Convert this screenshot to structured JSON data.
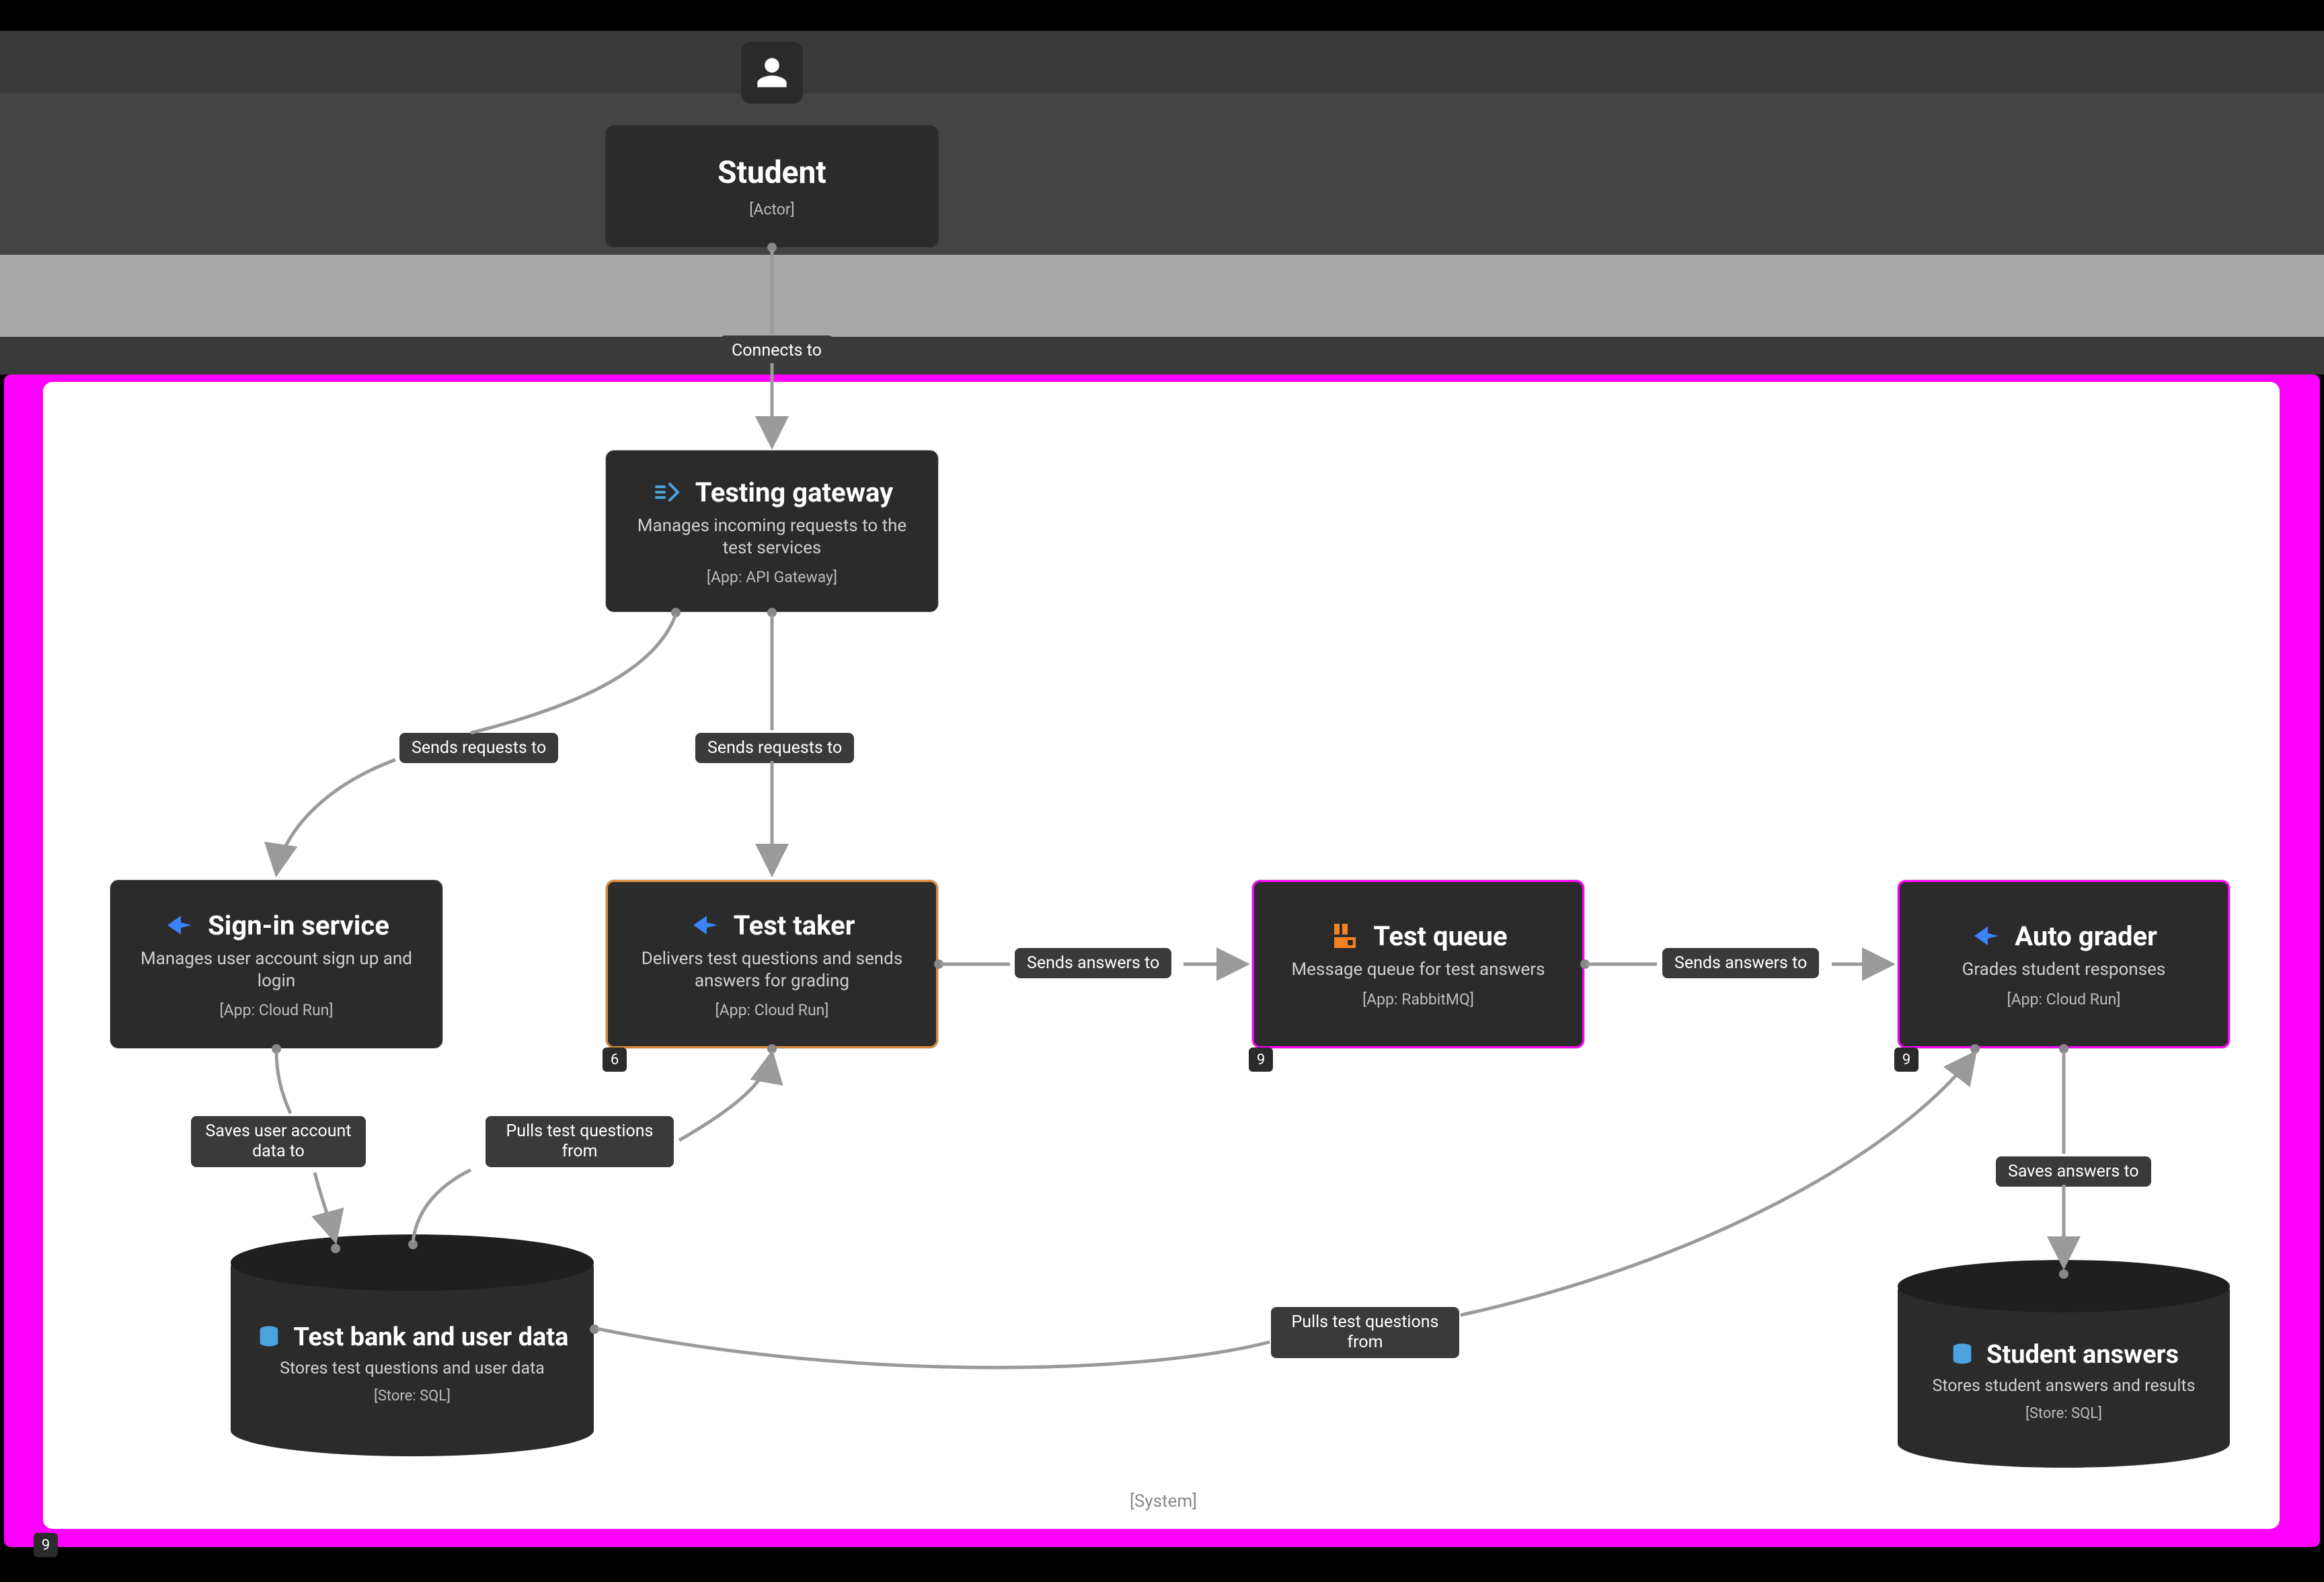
{
  "actor": {
    "title": "Student",
    "tag": "[Actor]"
  },
  "nodes": {
    "gateway": {
      "title": "Testing gateway",
      "desc": "Manages incoming requests to the test services",
      "tag": "[App: API Gateway]",
      "icon": "api-gateway-icon"
    },
    "signin": {
      "title": "Sign-in service",
      "desc": "Manages user account sign up and login",
      "tag": "[App: Cloud Run]",
      "icon": "cloud-run-icon"
    },
    "testtaker": {
      "title": "Test taker",
      "desc": "Delivers test questions and sends answers for grading",
      "tag": "[App: Cloud Run]",
      "icon": "cloud-run-icon",
      "badge": "6"
    },
    "queue": {
      "title": "Test queue",
      "desc": "Message queue for test answers",
      "tag": "[App: RabbitMQ]",
      "icon": "rabbitmq-icon",
      "badge": "9"
    },
    "grader": {
      "title": "Auto grader",
      "desc": "Grades student responses",
      "tag": "[App: Cloud Run]",
      "icon": "cloud-run-icon",
      "badge": "9"
    }
  },
  "stores": {
    "testbank": {
      "title": "Test bank and user data",
      "desc": "Stores test questions and user data",
      "tag": "[Store: SQL]",
      "icon": "database-icon"
    },
    "answers": {
      "title": "Student answers",
      "desc": "Stores student answers and results",
      "tag": "[Store: SQL]",
      "icon": "database-icon"
    }
  },
  "edges": {
    "connects": "Connects to",
    "sends_req_signin": "Sends requests to",
    "sends_req_taker": "Sends requests to",
    "sends_answers_queue": "Sends answers to",
    "sends_answers_grader": "Sends answers to",
    "saves_user": "Saves user account data to",
    "pulls_questions_taker": "Pulls test questions from",
    "pulls_questions_grader": "Pulls test questions from",
    "saves_answers": "Saves answers to"
  },
  "container": {
    "system_tag": "[System]",
    "outer_badge": "9"
  }
}
